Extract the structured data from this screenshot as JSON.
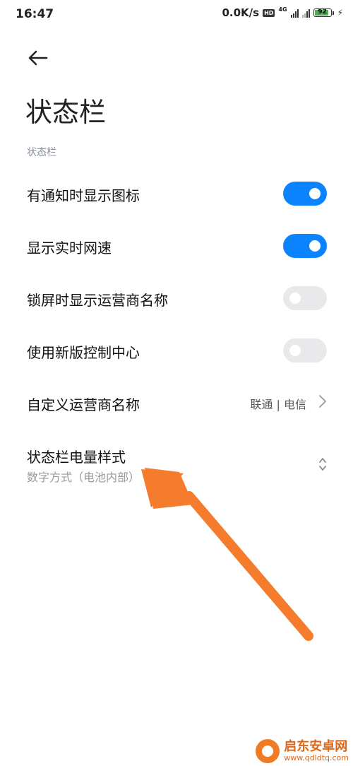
{
  "status_bar": {
    "time": "16:47",
    "net_speed": "0.0K/s",
    "hd_badge": "HD",
    "network_type": "4G",
    "battery_level": "92",
    "battery_fraction": 0.92,
    "battery_color": "#4caf50"
  },
  "header": {
    "title": "状态栏"
  },
  "section_label": "状态栏",
  "settings": [
    {
      "label": "有通知时显示图标",
      "toggle": true
    },
    {
      "label": "显示实时网速",
      "toggle": true
    },
    {
      "label": "锁屏时显示运营商名称",
      "toggle": false
    },
    {
      "label": "使用新版控制中心",
      "toggle": false
    }
  ],
  "carrier_row": {
    "label": "自定义运营商名称",
    "value": "联通 | 电信"
  },
  "battery_style_row": {
    "label": "状态栏电量样式",
    "sublabel": "数字方式（电池内部）"
  },
  "watermark": {
    "name": "启东安卓网",
    "url": "www.qdldtq.com"
  },
  "colors": {
    "accent": "#0d84ff",
    "annotation_arrow": "#f47c2c"
  }
}
